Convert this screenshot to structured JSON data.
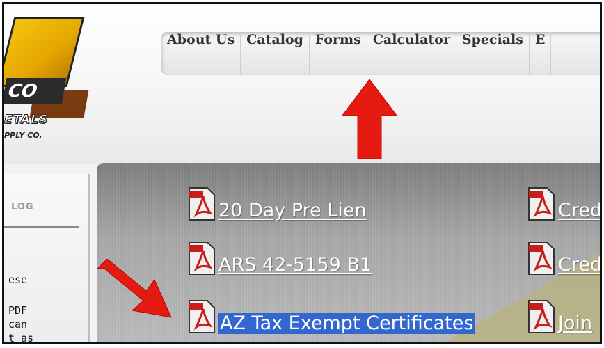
{
  "logo": {
    "metals_text": "ETALS",
    "supply_text": "PPLY CO.",
    "co_text": "CO"
  },
  "nav": {
    "items": [
      "About Us",
      "Catalog",
      "Forms",
      "Calculator",
      "Specials",
      "E"
    ]
  },
  "sidebar": {
    "category_label": "LOG",
    "lines": [
      "ese",
      "PDF",
      "can",
      "t as"
    ]
  },
  "documents": {
    "left": [
      "20 Day Pre Lien",
      "ARS 42-5159 B1",
      "AZ Tax Exempt Certificates"
    ],
    "right": [
      "Cred",
      "Cred",
      "Join"
    ]
  },
  "colors": {
    "arrow": "#e51b12",
    "selection": "#3267d0",
    "icon_red": "#c81d18"
  }
}
